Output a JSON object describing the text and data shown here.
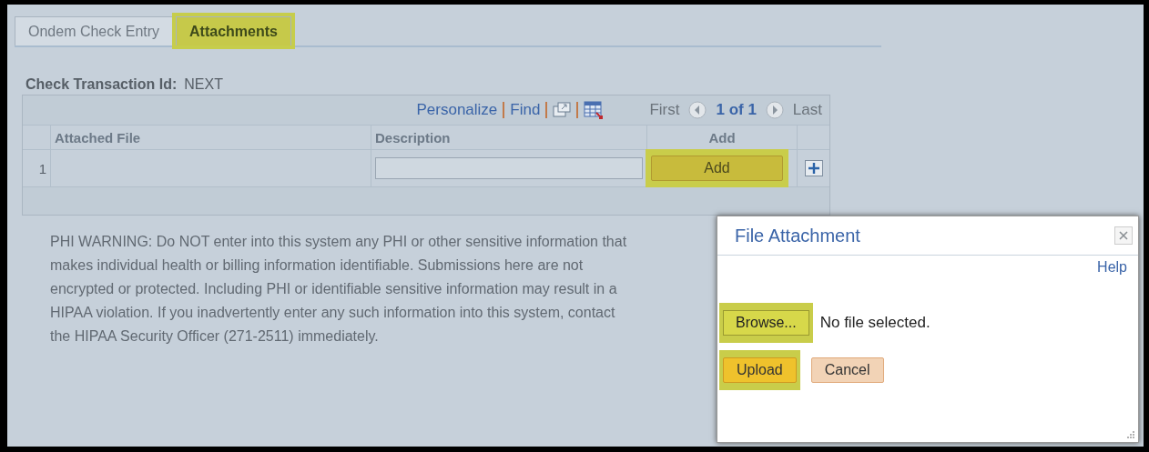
{
  "tabs": [
    {
      "label": "Ondem Check Entry",
      "selected": false,
      "highlighted": false
    },
    {
      "label": "Attachments",
      "selected": true,
      "highlighted": true
    }
  ],
  "transaction": {
    "label": "Check Transaction Id:",
    "value": "NEXT"
  },
  "grid": {
    "toolbar": {
      "links": [
        "Personalize",
        "Find"
      ],
      "first": "First",
      "range": "1 of 1",
      "last": "Last"
    },
    "columns": [
      "Attached File",
      "Description",
      "Add"
    ],
    "rows": [
      {
        "number": "1",
        "add_button": "Add",
        "add_highlighted": true
      }
    ]
  },
  "warning": "PHI WARNING: Do NOT enter into this system any PHI or other sensitive information that makes individual health or billing information identifiable. Submissions here are not encrypted or protected. Including PHI or identifiable sensitive information may result in a HIPAA violation. If you inadvertently enter any such information into this system, contact the HIPAA Security Officer (271-2511) immediately.",
  "dialog": {
    "title": "File Attachment",
    "help": "Help",
    "browse": {
      "label": "Browse...",
      "highlighted": true
    },
    "file_status": "No file selected.",
    "buttons": [
      {
        "label": "Upload",
        "kind": "primary",
        "highlighted": true
      },
      {
        "label": "Cancel",
        "kind": "secondary",
        "highlighted": false
      }
    ]
  }
}
